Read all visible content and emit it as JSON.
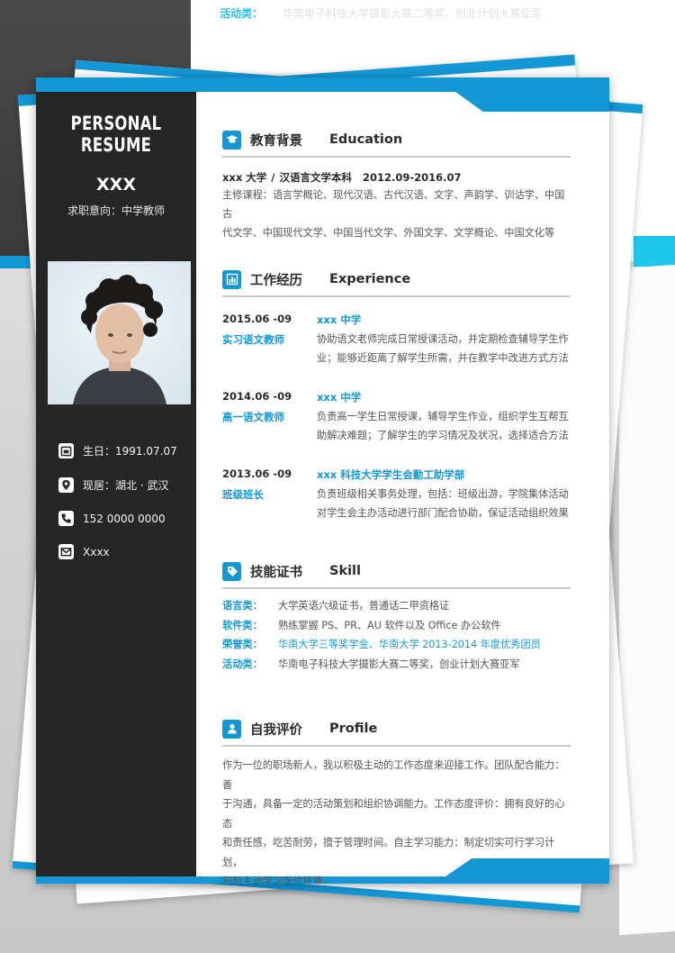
{
  "background": {
    "top_snippet_label": "活动类：",
    "top_snippet_value": "华南电子科技大学摄影大赛二等奖，创业计划大赛亚军"
  },
  "sidebar": {
    "title": "PERSONAL RESUME",
    "name": "XXX",
    "intent": "求职意向：中学教师",
    "contacts": [
      {
        "icon": "calendar-icon",
        "text": "生日：1991.07.07"
      },
      {
        "icon": "location-pin-icon",
        "text": "现居：湖北 · 武汉"
      },
      {
        "icon": "phone-icon",
        "text": "152 0000 0000"
      },
      {
        "icon": "envelope-icon",
        "text": "Xxxx"
      }
    ]
  },
  "education": {
    "title_cn": "教育背景",
    "title_en": "Education",
    "school": "xxx 大学",
    "separator": "/",
    "major": "汉语言文学本科",
    "dates": "2012.09-2016.07",
    "courses_line1": "主修课程：语言学概论、现代汉语、古代汉语、文字、声韵学、训诂学、中国古",
    "courses_line2": "代文学、中国现代文学、中国当代文学、外国文学、文学概论、中国文化等"
  },
  "experience": {
    "title_cn": "工作经历",
    "title_en": "Experience",
    "jobs": [
      {
        "date": "2015.06 -09",
        "role": "实习语文教师",
        "org": "xxx 中学",
        "line1": "协助语文老师完成日常授课活动，并定期检查辅导学生作",
        "line2": "业；能够近距离了解学生所需，并在教学中改进方式方法"
      },
      {
        "date": "2014.06 -09",
        "role": "高一语文教师",
        "org": "xxx 中学",
        "line1": "负责高一学生日常授课，辅导学生作业，组织学生互帮互",
        "line2": "助解决难题；了解学生的学习情况及状况，选择适合方法"
      },
      {
        "date": "2013.06 -09",
        "role": "班级班长",
        "org": "xxx 科技大学学生会勤工助学部",
        "line1": "负责班级相关事务处理，包括：班级出游，学院集体活动",
        "line2": "对学生会主办活动进行部门配合协助，保证活动组织效果"
      }
    ]
  },
  "skills": {
    "title_cn": "技能证书",
    "title_en": "Skill",
    "rows": [
      {
        "key": "语言类：",
        "value": "大学英语六级证书，普通话二甲资格证"
      },
      {
        "key": "软件类：",
        "value": "熟练掌握 PS、PR、AU 软件以及 Office 办公软件"
      },
      {
        "key": "荣誉类：",
        "value": "华南大学三等奖学金、华南大学 2013-2014 年度优秀团员"
      },
      {
        "key": "活动类：",
        "value": "华南电子科技大学摄影大赛二等奖，创业计划大赛亚军"
      }
    ]
  },
  "profile": {
    "title_cn": "自我评价",
    "title_en": "Profile",
    "lines": [
      "作为一位的职场新人，我以积极主动的工作态度来迎接工作。团队配合能力：善",
      "于沟通，具备一定的活动策划和组织协调能力。工作态度评价：拥有良好的心态",
      "和责任感，吃苦耐劳，擅于管理时间。自主学习能力：制定切实可行学习计划，",
      "积极主动学习岗位技能。"
    ]
  },
  "colors": {
    "accent": "#1497d5",
    "sidebar": "#262626",
    "text": "#2b2b2b",
    "muted": "#555555"
  }
}
